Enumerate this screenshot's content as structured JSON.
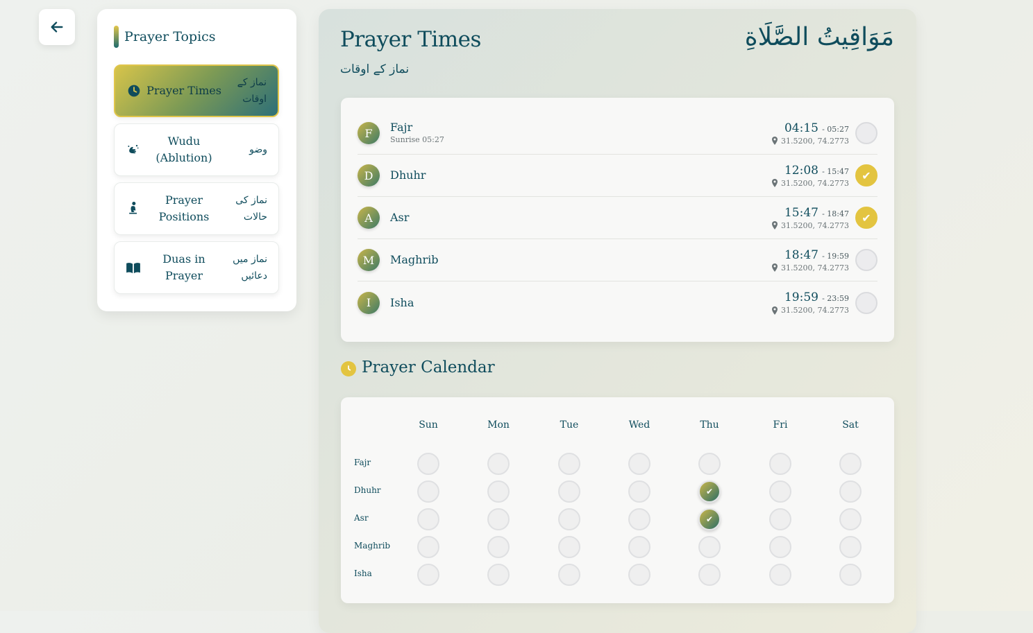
{
  "sidebar": {
    "title": "Prayer Topics",
    "items": [
      {
        "en": "Prayer Times",
        "ur": "نماز کے اوقات",
        "icon": "clock-icon",
        "active": true
      },
      {
        "en": "Wudu (Ablution)",
        "ur": "وضو",
        "icon": "hands-wash-icon",
        "active": false
      },
      {
        "en": "Prayer Positions",
        "ur": "نماز کی حالات",
        "icon": "praying-person-icon",
        "active": false
      },
      {
        "en": "Duas in Prayer",
        "ur": "نماز میں دعائیں",
        "icon": "open-book-icon",
        "active": false
      }
    ]
  },
  "header": {
    "title": "Prayer Times",
    "subtitle_ur": "نماز کے اوقات",
    "title_ar": "مَوَاقِيتُ الصَّلَاةِ"
  },
  "prayers": [
    {
      "letter": "F",
      "name": "Fajr",
      "sub": "Sunrise 05:27",
      "start": "04:15",
      "end": "- 05:27",
      "loc": "31.5200, 74.2773",
      "done": false
    },
    {
      "letter": "D",
      "name": "Dhuhr",
      "sub": "",
      "start": "12:08",
      "end": "- 15:47",
      "loc": "31.5200, 74.2773",
      "done": true
    },
    {
      "letter": "A",
      "name": "Asr",
      "sub": "",
      "start": "15:47",
      "end": "- 18:47",
      "loc": "31.5200, 74.2773",
      "done": true
    },
    {
      "letter": "M",
      "name": "Maghrib",
      "sub": "",
      "start": "18:47",
      "end": "- 19:59",
      "loc": "31.5200, 74.2773",
      "done": false
    },
    {
      "letter": "I",
      "name": "Isha",
      "sub": "",
      "start": "19:59",
      "end": "- 23:59",
      "loc": "31.5200, 74.2773",
      "done": false
    }
  ],
  "calendar": {
    "title": "Prayer Calendar",
    "days": [
      "Sun",
      "Mon",
      "Tue",
      "Wed",
      "Thu",
      "Fri",
      "Sat"
    ],
    "rows": [
      "Fajr",
      "Dhuhr",
      "Asr",
      "Maghrib",
      "Isha"
    ],
    "checked": [
      [
        1,
        4
      ],
      [
        2,
        4
      ]
    ]
  },
  "colors": {
    "accent": "#e3c440",
    "primary": "#0f4c5c"
  }
}
